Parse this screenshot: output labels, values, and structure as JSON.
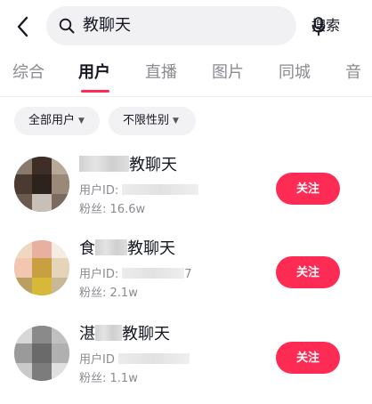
{
  "header": {
    "back_icon": "chevron-left-icon",
    "search_icon": "search-icon",
    "mic_icon": "microphone-icon",
    "query": "教聊天",
    "search_button": "搜索"
  },
  "tabs": [
    {
      "label": "综合",
      "active": false
    },
    {
      "label": "用户",
      "active": true
    },
    {
      "label": "直播",
      "active": false
    },
    {
      "label": "图片",
      "active": false
    },
    {
      "label": "同城",
      "active": false
    },
    {
      "label": "音",
      "active": false
    }
  ],
  "filters": [
    {
      "label": "全部用户",
      "icon": "caret-down-icon"
    },
    {
      "label": "不限性别",
      "icon": "caret-down-icon"
    }
  ],
  "users": [
    {
      "name_visible": "教聊天",
      "id_label": "用户ID:",
      "id_value": "",
      "fans_label": "粉丝:",
      "fans": "16.6w",
      "follow_label": "关注"
    },
    {
      "name_prefix": "食",
      "name_visible": "教聊天",
      "id_label": "用户ID:",
      "id_value": "7",
      "fans_label": "粉丝:",
      "fans": "2.1w",
      "follow_label": "关注"
    },
    {
      "name_prefix": "湛",
      "name_visible": "教聊天",
      "id_label": "用户ID",
      "id_value": "",
      "fans_label": "粉丝:",
      "fans": "1.1w",
      "follow_label": "关注"
    }
  ],
  "colors": {
    "accent": "#fe2c55",
    "text_primary": "#161823",
    "text_secondary": "#8a8b91",
    "chip_bg": "#f2f2f4",
    "search_bg": "#f1f1f3"
  }
}
